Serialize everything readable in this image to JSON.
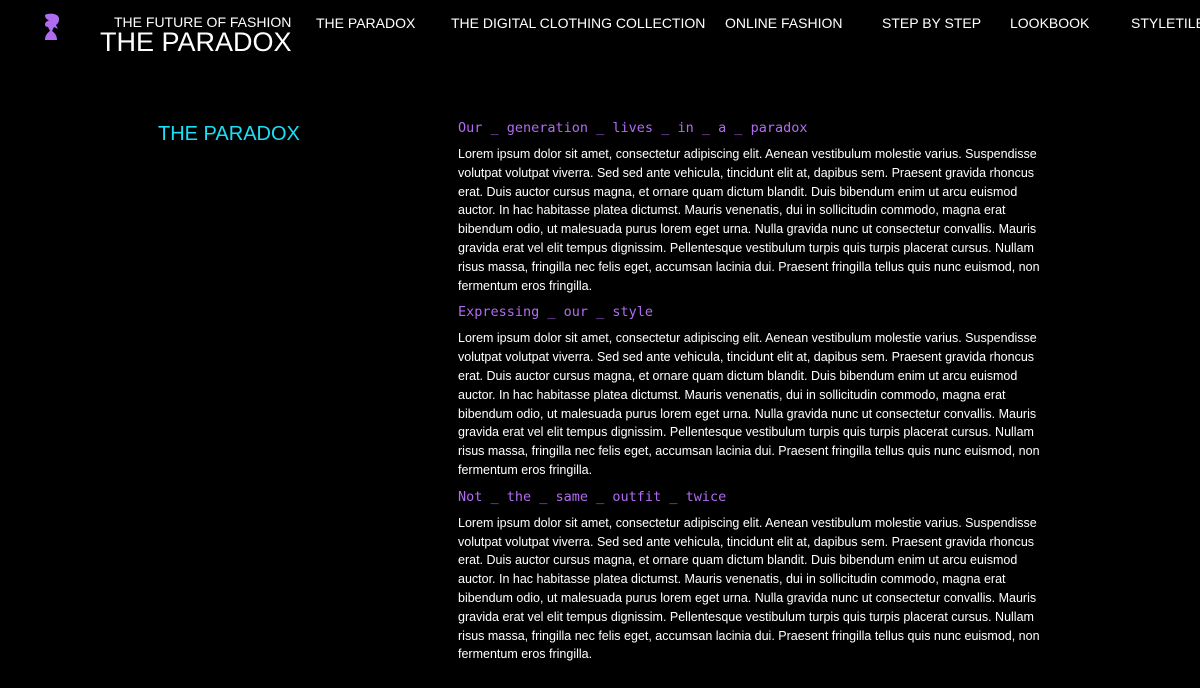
{
  "header": {
    "tagline": "THE FUTURE OF FASHION",
    "title": "THE PARADOX"
  },
  "nav": [
    {
      "label": "THE PARADOX"
    },
    {
      "label": "THE DIGITAL CLOTHING COLLECTION"
    },
    {
      "label": "ONLINE FASHION"
    },
    {
      "label": "STEP BY STEP"
    },
    {
      "label": "LOOKBOOK"
    },
    {
      "label": "STYLETILE"
    }
  ],
  "page": {
    "heading": "THE PARADOX",
    "sections": [
      {
        "title": "Our _ generation _ lives _ in _ a _ paradox",
        "body": "Lorem ipsum dolor sit amet, consectetur adipiscing elit. Aenean vestibulum molestie varius. Suspendisse volutpat volutpat viverra. Sed sed ante vehicula, tincidunt elit at, dapibus sem. Praesent gravida rhoncus erat. Duis auctor cursus magna, et ornare quam dictum blandit. Duis bibendum enim ut arcu euismod auctor. In hac habitasse platea dictumst. Mauris venenatis, dui in sollicitudin commodo, magna erat bibendum odio, ut malesuada purus lorem eget urna. Nulla gravida nunc ut consectetur convallis. Mauris gravida erat vel elit tempus dignissim. Pellentesque vestibulum turpis quis turpis placerat cursus. Nullam risus massa, fringilla nec felis eget, accumsan lacinia dui. Praesent fringilla tellus quis nunc euismod, non fermentum eros fringilla."
      },
      {
        "title": "Expressing _ our _ style",
        "body": "Lorem ipsum dolor sit amet, consectetur adipiscing elit. Aenean vestibulum molestie varius. Suspendisse volutpat volutpat viverra. Sed sed ante vehicula, tincidunt elit at, dapibus sem. Praesent gravida rhoncus erat. Duis auctor cursus magna, et ornare quam dictum blandit. Duis bibendum enim ut arcu euismod auctor. In hac habitasse platea dictumst. Mauris venenatis, dui in sollicitudin commodo, magna erat bibendum odio, ut malesuada purus lorem eget urna. Nulla gravida nunc ut consectetur convallis. Mauris gravida erat vel elit tempus dignissim. Pellentesque vestibulum turpis quis turpis placerat cursus. Nullam risus massa, fringilla nec felis eget, accumsan lacinia dui. Praesent fringilla tellus quis nunc euismod, non fermentum eros fringilla."
      },
      {
        "title": "Not _ the _ same _ outfit _ twice",
        "body": "Lorem ipsum dolor sit amet, consectetur adipiscing elit. Aenean vestibulum molestie varius. Suspendisse volutpat volutpat viverra. Sed sed ante vehicula, tincidunt elit at, dapibus sem. Praesent gravida rhoncus erat. Duis auctor cursus magna, et ornare quam dictum blandit. Duis bibendum enim ut arcu euismod auctor. In hac habitasse platea dictumst. Mauris venenatis, dui in sollicitudin commodo, magna erat bibendum odio, ut malesuada purus lorem eget urna. Nulla gravida nunc ut consectetur convallis. Mauris gravida erat vel elit tempus dignissim. Pellentesque vestibulum turpis quis turpis placerat cursus. Nullam risus massa, fringilla nec felis eget, accumsan lacinia dui. Praesent fringilla tellus quis nunc euismod, non fermentum eros fringilla."
      }
    ]
  },
  "colors": {
    "background": "#000000",
    "heading_accent": "#19e0f5",
    "subheading_accent": "#b06cf0",
    "logo": "#b06cf0"
  },
  "icons": {
    "logo": "chess-knight-logo-icon"
  }
}
